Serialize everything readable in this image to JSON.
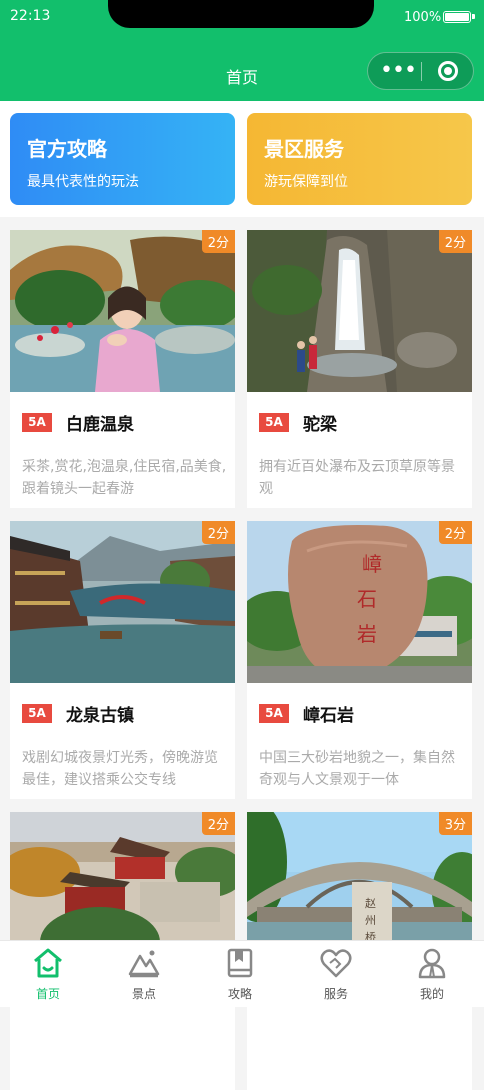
{
  "status": {
    "time": "22:13",
    "battery": "100%"
  },
  "header": {
    "title": "首页"
  },
  "promo": [
    {
      "title": "官方攻略",
      "subtitle": "最具代表性的玩法"
    },
    {
      "title": "景区服务",
      "subtitle": "游玩保障到位"
    }
  ],
  "cards": [
    {
      "badge": "2分",
      "level": "5A",
      "name": "白鹿温泉",
      "desc": "采茶,赏花,泡温泉,住民宿,品美食,跟着镜头一起春游"
    },
    {
      "badge": "2分",
      "level": "5A",
      "name": "驼梁",
      "desc": "拥有近百处瀑布及云顶草原等景观"
    },
    {
      "badge": "2分",
      "level": "5A",
      "name": "龙泉古镇",
      "desc": "戏剧幻城夜景灯光秀，傍晚游览最佳，建议搭乘公交专线"
    },
    {
      "badge": "2分",
      "level": "5A",
      "name": "嶂石岩",
      "desc": "中国三大砂岩地貌之一，集自然奇观与人文景观于一体"
    },
    {
      "badge": "2分"
    },
    {
      "badge": "3分"
    }
  ],
  "tabs": [
    {
      "label": "首页",
      "icon": "home-icon",
      "active": true
    },
    {
      "label": "景点",
      "icon": "mountain-icon"
    },
    {
      "label": "攻略",
      "icon": "book-icon"
    },
    {
      "label": "服务",
      "icon": "heart-handshake-icon"
    },
    {
      "label": "我的",
      "icon": "user-icon"
    }
  ],
  "colors": {
    "brand": "#12bf6c",
    "badge": "#f08a28",
    "level": "#e84a3f"
  }
}
